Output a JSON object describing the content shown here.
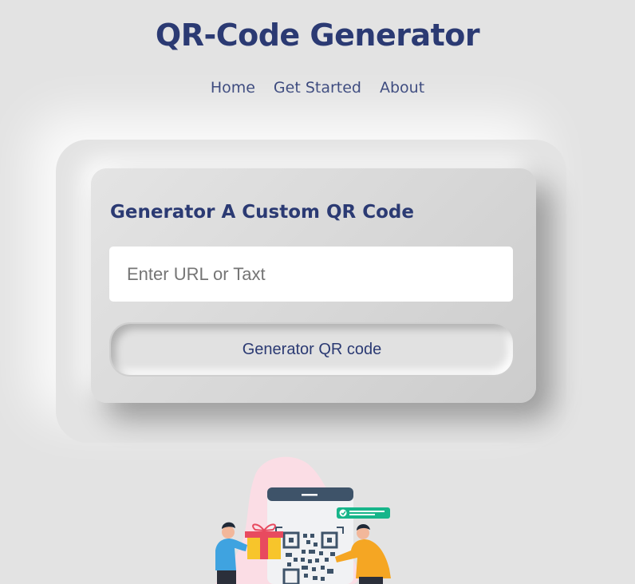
{
  "header": {
    "title": "QR-Code Generator"
  },
  "nav": {
    "items": [
      "Home",
      "Get Started",
      "About"
    ]
  },
  "card": {
    "title": "Generator A Custom QR Code",
    "input_placeholder": "Enter URL or Taxt",
    "input_value": "",
    "button_label": "Generator QR code"
  },
  "colors": {
    "background": "#e3e3e3",
    "accent": "#2b3a73",
    "blob": "#fbdde5",
    "phone_top": "#3e5369",
    "notify": "#17b58a",
    "gift": "#f7c52b",
    "ribbon": "#e84a5f"
  },
  "illustration": {
    "name": "qr-scan-illustration"
  }
}
